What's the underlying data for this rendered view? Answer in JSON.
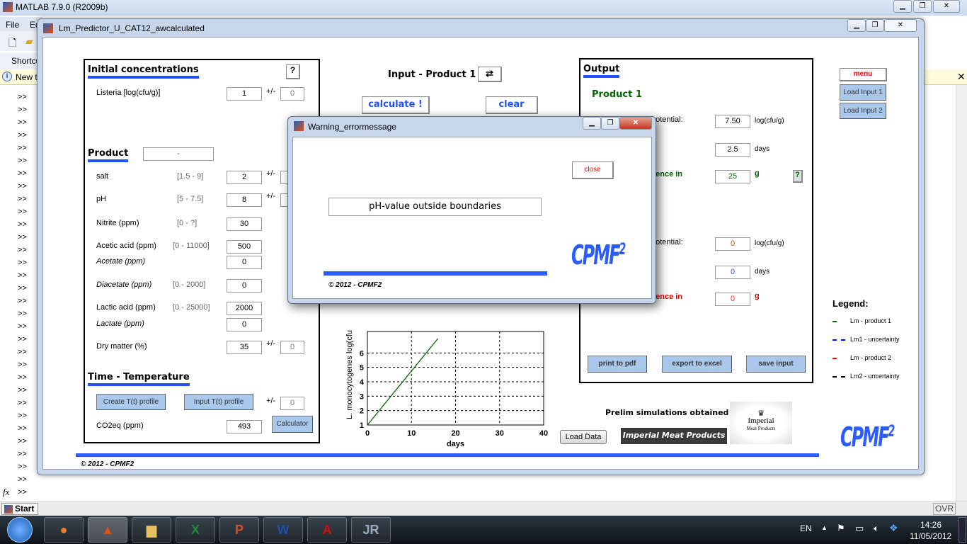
{
  "matlab": {
    "title": "MATLAB  7.9.0 (R2009b)",
    "menu": [
      "File",
      "Ed"
    ],
    "shortcuts": "Shortcu",
    "info": "New t",
    "prompt": ">>",
    "fx": "fx",
    "start": "Start",
    "ovr": "OVR"
  },
  "figure": {
    "title": "Lm_Predictor_U_CAT12_awcalculated"
  },
  "initial": {
    "title": "Initial concentrations",
    "help": "?",
    "listeria_label": "Listeria [log(cfu/g)]",
    "listeria": "1",
    "pm": "+/-",
    "listeria_unc": "0"
  },
  "product": {
    "title": "Product",
    "name": "-",
    "rows": [
      {
        "label": "salt",
        "range": "[1.5 - 9]",
        "value": "2",
        "pm": "+/-"
      },
      {
        "label": "pH",
        "range": "[5 - 7.5]",
        "value": "8",
        "pm": "+/-"
      },
      {
        "label": "Nitrite (ppm)",
        "range": "[0 - ?]",
        "value": "30"
      },
      {
        "label": "Acetic acid (ppm)",
        "range": "[0 - 11000]",
        "value": "500"
      },
      {
        "label": "Acetate (ppm)",
        "value": "0"
      },
      {
        "label": "Diacetate (ppm)",
        "range": "[0 - 2000]",
        "value": "0"
      },
      {
        "label": "Lactic acid (ppm)",
        "range": "[0 - 25000]",
        "value": "2000"
      },
      {
        "label": "Lactate (ppm)",
        "value": "0"
      },
      {
        "label": "Dry matter (%)",
        "value": "35",
        "pm": "+/-",
        "unc": "0"
      }
    ]
  },
  "time": {
    "title": "Time - Temperature",
    "create": "Create T(t) profile",
    "input": "Input T(t) profile",
    "pm": "+/-",
    "unc": "0",
    "co2_label": "CO2eq (ppm)",
    "co2": "493",
    "calculator": "Calculator"
  },
  "input": {
    "title": "Input - Product 1",
    "calculate": "calculate !",
    "clear": "clear"
  },
  "chart_data": {
    "type": "line",
    "xlabel": "days",
    "ylabel": "L. monocytogenes log(cfu",
    "xlim": [
      0,
      40
    ],
    "ylim": [
      1,
      7
    ],
    "xticks": [
      "0",
      "10",
      "20",
      "30",
      "40"
    ],
    "yticks": [
      "1",
      "2",
      "3",
      "4",
      "5",
      "6"
    ],
    "grid": true,
    "series": [
      {
        "color": "#006400",
        "x": [
          0,
          16
        ],
        "y": [
          1,
          7
        ]
      }
    ]
  },
  "output": {
    "title": "Output",
    "product1": "Product 1",
    "p1_growth_label": "potential:",
    "p1_growth": "7.50",
    "unit_log": "log(cfu/g)",
    "p1_days": "2.5",
    "unit_days": "days",
    "p1_absence_label": "sence in",
    "p1_absence": "25",
    "unit_g": "g",
    "help": "?",
    "p2_growth_label": "potential:",
    "p2_growth": "0",
    "p2_days": "0",
    "p2_absence_label": "sence in",
    "p2_absence": "0",
    "print": "print to pdf",
    "export": "export to excel",
    "save": "save input"
  },
  "side": {
    "menu": "menu",
    "load1": "Load Input 1",
    "load2": "Load Input 2"
  },
  "legend": {
    "title": "Legend:",
    "items": [
      {
        "label": "Lm - product 1",
        "color": "#006400"
      },
      {
        "label": "Lm1 - uncertainty",
        "color": "#0000ff"
      },
      {
        "label": "Lm - product 2",
        "color": "#ff0000"
      },
      {
        "label": "Lm2 - uncertainty",
        "color": "#000000"
      }
    ]
  },
  "footer": {
    "prelim": "Prelim simulations obtained by",
    "load_data": "Load Data",
    "imperial": "Imperial Meat Products",
    "imperial_logo": "Imperial Meat Products",
    "copyright": "© 2012 - CPMF2",
    "logo": "CPMF2"
  },
  "dialog": {
    "title": "Warning_errormessage",
    "close": "close",
    "message": "pH-value outside boundaries",
    "copyright": "© 2012 - CPMF2",
    "logo": "CPMF2"
  },
  "tray": {
    "lang": "EN",
    "time": "14:26",
    "date": "11/05/2012"
  }
}
